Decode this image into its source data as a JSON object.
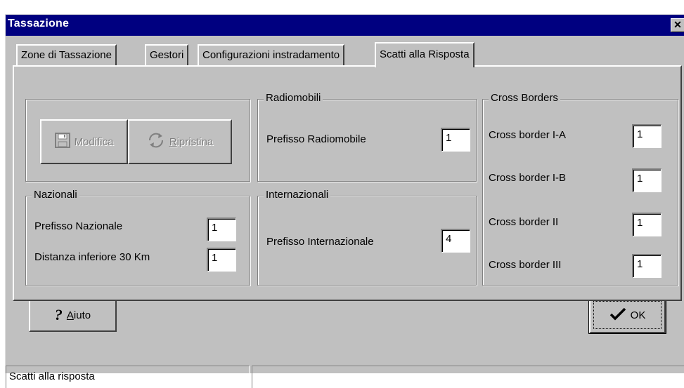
{
  "window": {
    "title": "Tassazione",
    "close_label": "✕"
  },
  "tabs": [
    {
      "label": "Zone di Tassazione",
      "active": false
    },
    {
      "label": "Gestori",
      "active": false
    },
    {
      "label": "Configurazioni instradamento",
      "active": false
    },
    {
      "label": "Scatti alla Risposta",
      "active": true
    }
  ],
  "actions": {
    "modifica": {
      "label": "Modifica",
      "icon": "floppy-disk-icon",
      "enabled": false
    },
    "ripristina": {
      "label_underlined": "R",
      "label_rest": "ipristina",
      "icon": "restore-arrows-icon",
      "enabled": false
    }
  },
  "radiomobili": {
    "title": "Radiomobili",
    "prefisso_label": "Prefisso Radiomobile",
    "prefisso_value": "1"
  },
  "nazionali": {
    "title": "Nazionali",
    "prefisso_label": "Prefisso Nazionale",
    "prefisso_value": "1",
    "distanza_label": "Distanza inferiore 30 Km",
    "distanza_value": "1"
  },
  "internazionali": {
    "title": "Internazionali",
    "prefisso_label": "Prefisso Internazionale",
    "prefisso_value": "4"
  },
  "cross_borders": {
    "title": "Cross Borders",
    "items": [
      {
        "label": "Cross border I-A",
        "value": "1"
      },
      {
        "label": "Cross border I-B",
        "value": "1"
      },
      {
        "label": "Cross border II",
        "value": "1"
      },
      {
        "label": "Cross border III",
        "value": "1"
      }
    ]
  },
  "buttons": {
    "aiuto": {
      "mnemonic": "A",
      "rest": "iuto",
      "icon": "question-mark-icon"
    },
    "ok": {
      "label": "OK",
      "icon": "checkmark-icon"
    }
  },
  "statusbar": {
    "text": "Scatti alla risposta",
    "text2": ""
  },
  "colors": {
    "titlebar": "#000080",
    "face": "#c0c0c0",
    "disabled_text": "#808080"
  }
}
